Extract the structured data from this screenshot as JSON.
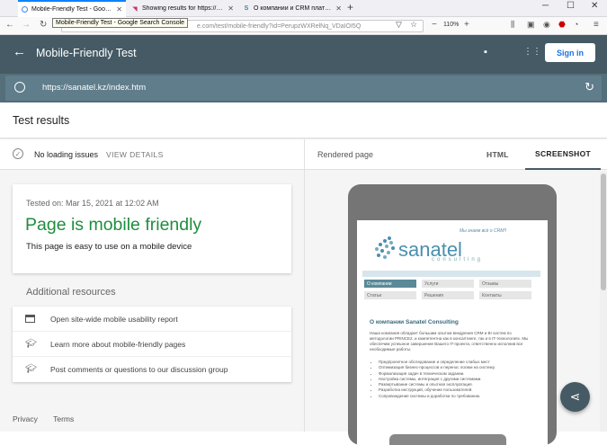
{
  "browser": {
    "tabs": [
      {
        "title": "Mobile-Friendly Test - Google Se",
        "active": true
      },
      {
        "title": "Showing results for https://sana"
      },
      {
        "title": "О компании и CRM платформе"
      }
    ],
    "tooltip": "Mobile-Friendly Test - Google Search Console",
    "url_visible": "e.com/test/mobile-friendly?id=PerupzWXRelNq_VDaIOI5Q",
    "zoom": "110%"
  },
  "app": {
    "title": "Mobile-Friendly Test",
    "sign_in": "Sign in",
    "tested_url": "https://sanatel.kz/index.htm"
  },
  "results": {
    "title": "Test results",
    "loading_status": "No loading issues",
    "view_details": "VIEW DETAILS",
    "tested_on": "Tested on: Mar 15, 2021 at 12:02 AM",
    "verdict": "Page is mobile friendly",
    "verdict_sub": "This page is easy to use on a mobile device",
    "additional_title": "Additional resources",
    "resources": [
      {
        "icon": "browser-window-icon",
        "label": "Open site-wide mobile usability report"
      },
      {
        "icon": "graduation-cap-icon",
        "label": "Learn more about mobile-friendly pages"
      },
      {
        "icon": "graduation-cap-icon",
        "label": "Post comments or questions to our discussion group"
      }
    ],
    "footer": {
      "privacy": "Privacy",
      "terms": "Terms"
    }
  },
  "preview": {
    "rendered_label": "Rendered page",
    "tab_html": "HTML",
    "tab_screenshot": "SCREENSHOT",
    "site": {
      "slogan": "Мы знаем всё о CRM!!",
      "logo": "sanatel",
      "logo_sub": "consulting",
      "menu": [
        "О компании",
        "Услуги",
        "Отзывы",
        "Статьи",
        "Решения",
        "Контакты"
      ],
      "heading": "О компании Sanatel Consulting",
      "paragraph": "Наша компания обладает большим опытом внедрения CRM и BI систем по методологии PRINCE2, и компетентна как в консалтинге, так и в IT-технологиях. Мы обеспечим успешное завершение Вашего IT-проекта, ответственно исполнив все необходимые работы.",
      "list": [
        "Предпроектное обследование и определение слабых мест",
        "Оптимизация бизнес-процессов и перенос логики на систему.",
        "Формализация задач в техническом задании.",
        "Настройка системы, интеграция с другими системами.",
        "Развертывание системы и опытная эксплуатация.",
        "Разработка инструкций, обучение пользователей.",
        "Сопровождение системы и доработки по требованию."
      ]
    }
  },
  "colors": {
    "header": "#455a64",
    "url_bar": "#607d8b",
    "success_green": "#1e8e3e",
    "link_blue": "#1a73e8"
  }
}
